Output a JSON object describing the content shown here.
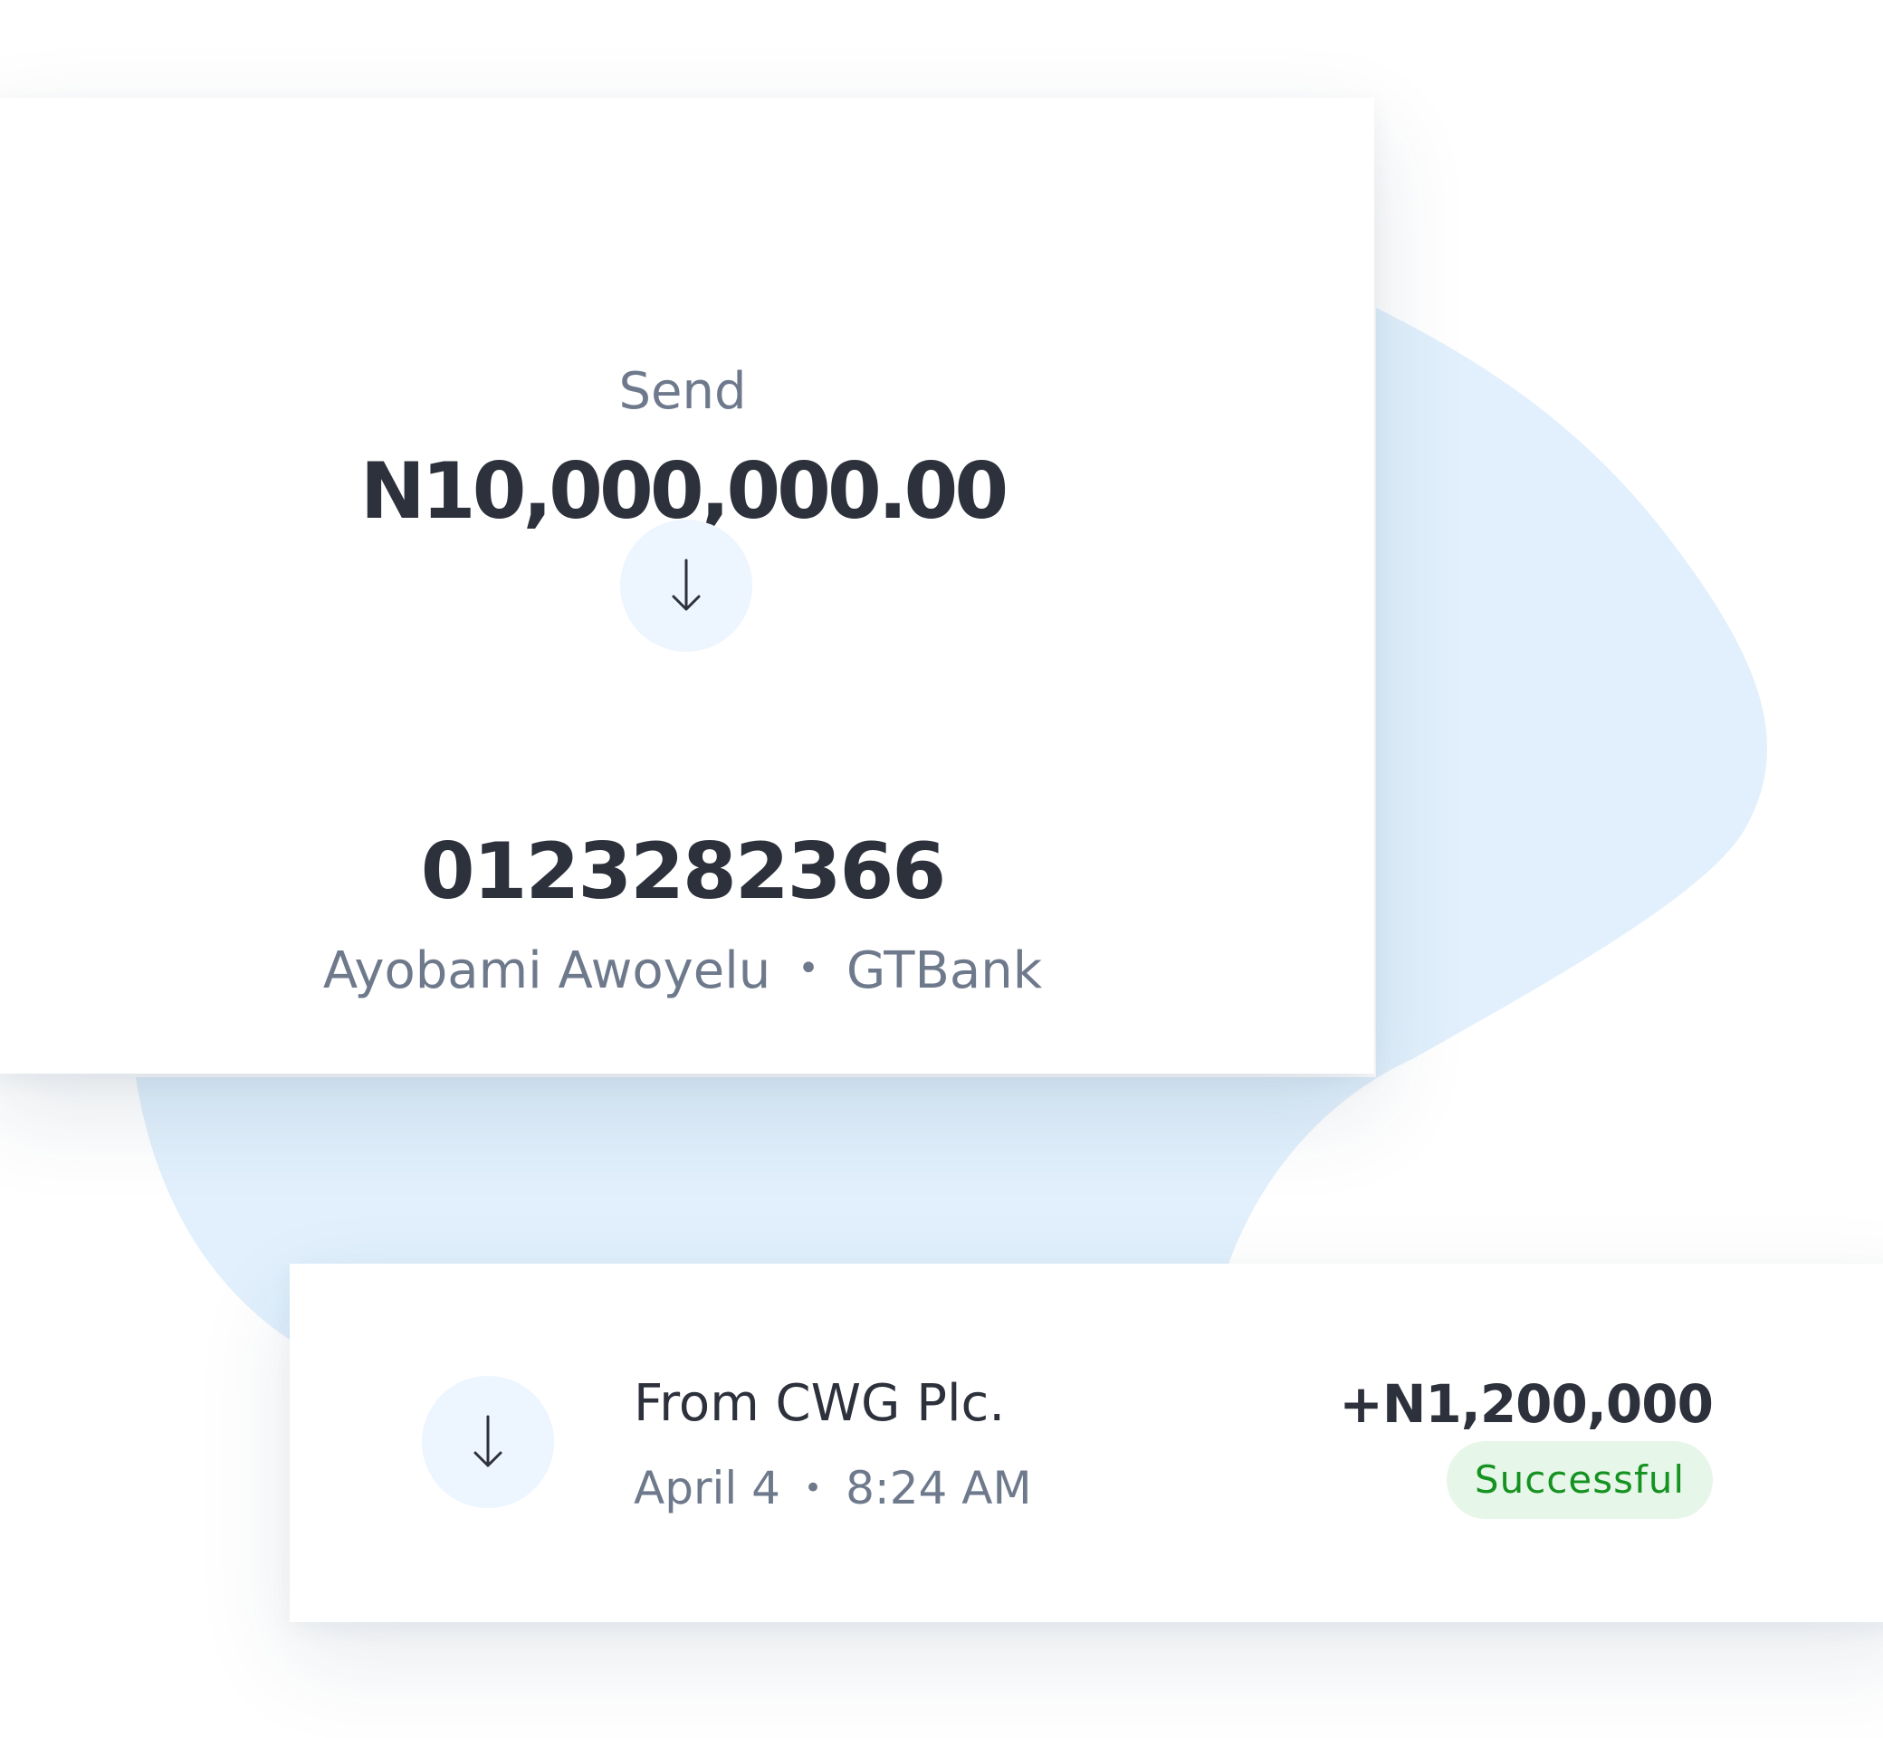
{
  "colors": {
    "text_primary": "#2d313c",
    "text_secondary": "#6e7a8c",
    "icon_circle": "#edf5fe",
    "blob": "#e1f0fc",
    "success_text": "#159221",
    "success_bg": "#e6f6e8"
  },
  "send_card": {
    "label": "Send",
    "amount": "N10,000,000.00",
    "arrow_icon": "arrow-down-icon",
    "account_number": "0123282366",
    "account_name": "Ayobami Awoyelu",
    "separator": "•",
    "bank": "GTBank"
  },
  "transaction": {
    "arrow_icon": "arrow-down-icon",
    "title": "From CWG Plc.",
    "date": "April 4",
    "separator": "•",
    "time": "8:24 AM",
    "amount": "+N1,200,000",
    "status": "Successful"
  }
}
